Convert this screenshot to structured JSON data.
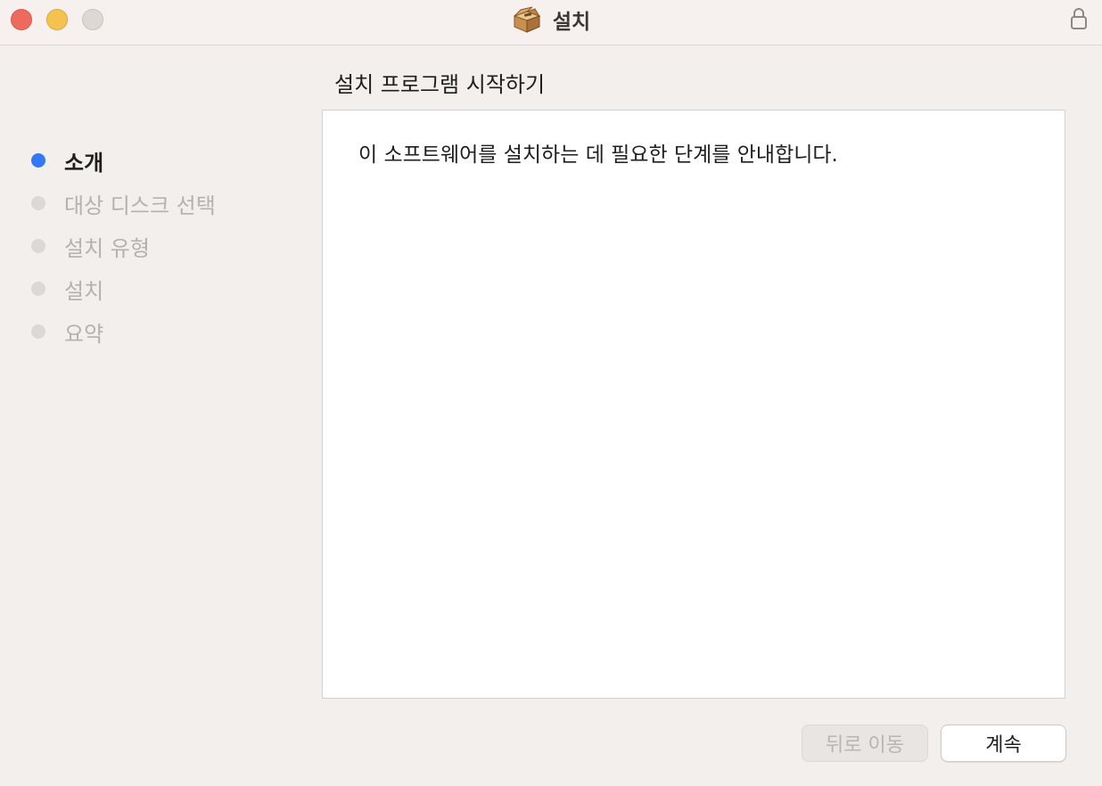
{
  "window": {
    "title": "설치",
    "title_icon": "installer-package-icon",
    "lock_icon": "lock-icon"
  },
  "sidebar": {
    "items": [
      {
        "label": "소개",
        "active": true
      },
      {
        "label": "대상 디스크 선택",
        "active": false
      },
      {
        "label": "설치 유형",
        "active": false
      },
      {
        "label": "설치",
        "active": false
      },
      {
        "label": "요약",
        "active": false
      }
    ]
  },
  "main": {
    "section_title": "설치 프로그램 시작하기",
    "body_text": "이 소프트웨어를 설치하는 데 필요한 단계를 안내합니다."
  },
  "buttons": {
    "back_label": "뒤로 이동",
    "continue_label": "계속"
  },
  "colors": {
    "accent": "#3478f6",
    "close": "#ee6a5f",
    "minimize": "#f5c250",
    "zoom_disabled": "#dcd8d4"
  }
}
